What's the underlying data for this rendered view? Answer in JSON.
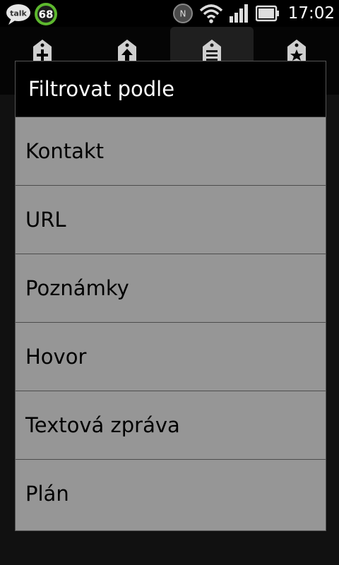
{
  "status_bar": {
    "notifications": [
      {
        "icon": "talk-icon",
        "label": "talk"
      },
      {
        "icon": "badge-icon",
        "label": "68"
      }
    ],
    "icons": [
      "nfc-icon",
      "wifi-icon",
      "signal-icon",
      "battery-icon"
    ],
    "time": "17:02"
  },
  "tabs": [
    {
      "icon": "add-tag-icon",
      "selected": false
    },
    {
      "icon": "upload-tag-icon",
      "selected": false
    },
    {
      "icon": "list-tag-icon",
      "selected": true
    },
    {
      "icon": "star-tag-icon",
      "selected": false
    }
  ],
  "dialog": {
    "title": "Filtrovat podle",
    "items": [
      {
        "label": "Kontakt"
      },
      {
        "label": "URL"
      },
      {
        "label": "Poznámky"
      },
      {
        "label": "Hovor"
      },
      {
        "label": "Textová zpráva"
      },
      {
        "label": "Plán"
      }
    ]
  },
  "colors": {
    "dialog_bg": "#969696",
    "title_bg": "#000000",
    "badge_green": "#5db82e"
  }
}
